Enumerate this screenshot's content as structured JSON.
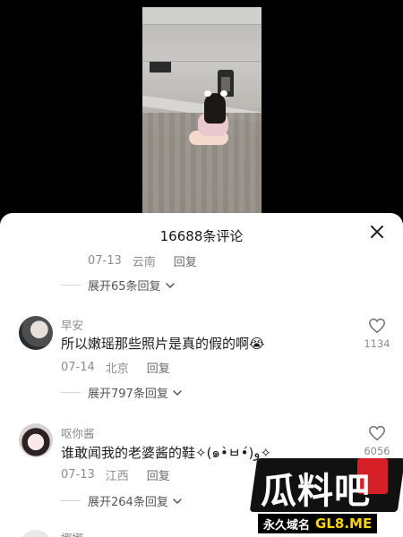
{
  "sheet": {
    "title": "16688条评论"
  },
  "comments": [
    {
      "date": "07-13",
      "location": "云南",
      "reply_label": "回复",
      "expand_label": "展开65条回复"
    },
    {
      "username": "早安",
      "text": "所以嫩瑶那些照片是真的假的啊😭",
      "date": "07-14",
      "location": "北京",
      "reply_label": "回复",
      "likes": "1134",
      "expand_label": "展开797条回复"
    },
    {
      "username": "呕你酱",
      "text": "谁敢闻我的老婆酱的鞋✧(๑•̀ㅂ•́)و✧",
      "date": "07-13",
      "location": "江西",
      "reply_label": "回复",
      "likes": "6056",
      "expand_label": "展开264条回复"
    },
    {
      "username": "娜娜"
    }
  ],
  "watermark": {
    "title": "瓜料吧",
    "sub_prefix": "永久域名",
    "domain": "GL8.ME"
  },
  "icons": {
    "close": "close-icon",
    "heart": "heart-icon",
    "chevron": "chevron-down-icon"
  },
  "colors": {
    "text": "#1c1c1c",
    "meta": "#8d8d8d",
    "watermark_red": "#d61f26",
    "watermark_yellow": "#ffd400"
  }
}
